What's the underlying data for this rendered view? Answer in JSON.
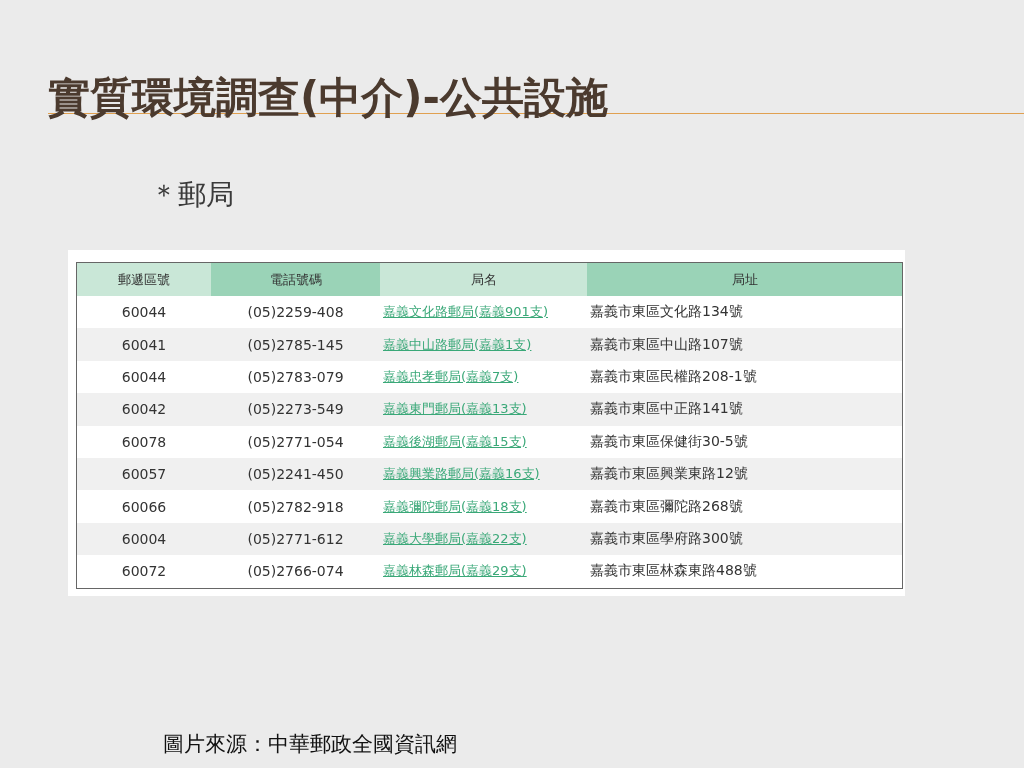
{
  "slide": {
    "title": "實質環境調查(中介)-公共設施",
    "bullet": "＊郵局",
    "caption": "圖片來源：中華郵政全國資訊網"
  },
  "table": {
    "columns": [
      "郵遞區號",
      "電話號碼",
      "局名",
      "局址"
    ],
    "rows": [
      {
        "zip": "60044",
        "phone": "(05)2259-408",
        "name": "嘉義文化路郵局(嘉義901支)",
        "address": "嘉義市東區文化路134號"
      },
      {
        "zip": "60041",
        "phone": "(05)2785-145",
        "name": "嘉義中山路郵局(嘉義1支)",
        "address": "嘉義市東區中山路107號"
      },
      {
        "zip": "60044",
        "phone": "(05)2783-079",
        "name": "嘉義忠孝郵局(嘉義7支)",
        "address": "嘉義市東區民權路208-1號"
      },
      {
        "zip": "60042",
        "phone": "(05)2273-549",
        "name": "嘉義東門郵局(嘉義13支)",
        "address": "嘉義市東區中正路141號"
      },
      {
        "zip": "60078",
        "phone": "(05)2771-054",
        "name": "嘉義後湖郵局(嘉義15支)",
        "address": "嘉義市東區保健街30-5號"
      },
      {
        "zip": "60057",
        "phone": "(05)2241-450",
        "name": "嘉義興業路郵局(嘉義16支)",
        "address": "嘉義市東區興業東路12號"
      },
      {
        "zip": "60066",
        "phone": "(05)2782-918",
        "name": "嘉義彌陀郵局(嘉義18支)",
        "address": "嘉義市東區彌陀路268號"
      },
      {
        "zip": "60004",
        "phone": "(05)2771-612",
        "name": "嘉義大學郵局(嘉義22支)",
        "address": "嘉義市東區學府路300號"
      },
      {
        "zip": "60072",
        "phone": "(05)2766-074",
        "name": "嘉義林森郵局(嘉義29支)",
        "address": "嘉義市東區林森東路488號"
      }
    ]
  }
}
